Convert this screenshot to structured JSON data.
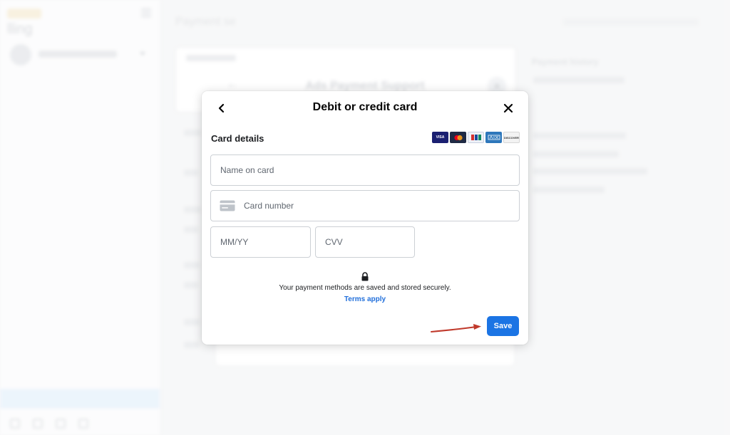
{
  "background": {
    "page_title": "Payment se",
    "sidebar_title": "lling",
    "history_title": "Payment history",
    "underlying_dialog_title": "Ads Payment Support"
  },
  "modal": {
    "title": "Debit or credit card",
    "back_icon": "chevron-left-icon",
    "close_icon": "close-icon",
    "section_title": "Card details",
    "card_brands": [
      "VISA",
      "Mastercard",
      "UnionPay",
      "AMEX",
      "DISCOVER"
    ],
    "fields": {
      "name_placeholder": "Name on card",
      "card_number_placeholder": "Card number",
      "expiry_placeholder": "MM/YY",
      "cvv_placeholder": "CVV"
    },
    "secure_text": "Your payment methods are saved and stored securely.",
    "terms_label": "Terms apply",
    "save_label": "Save"
  },
  "colors": {
    "primary": "#1b74e4",
    "link": "#216fdb",
    "annotation_arrow": "#c0392b"
  }
}
